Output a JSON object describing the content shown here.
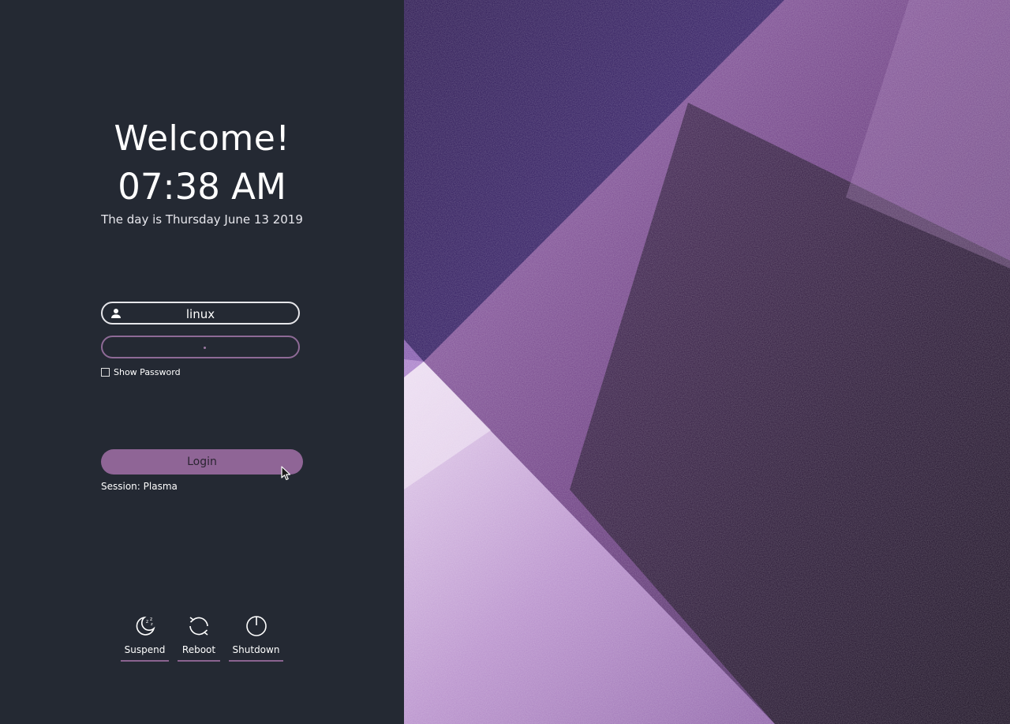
{
  "greeting": {
    "welcome": "Welcome!",
    "time": "07:38 AM",
    "date": "The day is Thursday June 13 2019"
  },
  "login": {
    "username": "linux",
    "username_icon": "user-icon",
    "password_masked": "•",
    "show_password_label": "Show Password",
    "show_password_checked": false,
    "login_label": "Login",
    "session": "Session: Plasma"
  },
  "power": {
    "suspend": "Suspend",
    "reboot": "Reboot",
    "shutdown": "Shutdown"
  },
  "colors": {
    "panel_bg": "#242933",
    "accent": "#8f6596",
    "text": "#ffffff",
    "wallpaper_dark": "#1a0f2a",
    "wallpaper_purple": "#6b3f84",
    "wallpaper_light": "#b48ac6"
  }
}
